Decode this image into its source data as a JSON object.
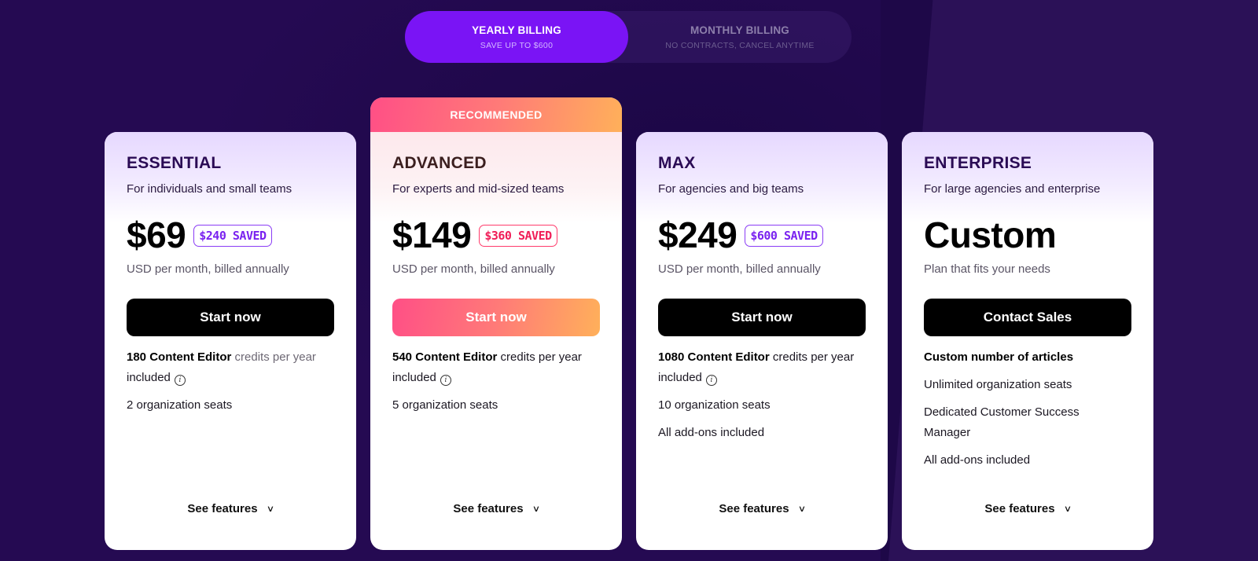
{
  "billing_toggle": {
    "selected": "yearly",
    "yearly": {
      "title": "YEARLY BILLING",
      "subtitle": "SAVE UP TO $600"
    },
    "monthly": {
      "title": "MONTHLY BILLING",
      "subtitle": "NO CONTRACTS, CANCEL ANYTIME"
    }
  },
  "colors": {
    "background": "#250a52",
    "accent_purple": "#7a14f5",
    "recommended_gradient": [
      "#ff4f86",
      "#ffb05a"
    ],
    "cta_dark": "#000000"
  },
  "plans": [
    {
      "name": "ESSENTIAL",
      "description": "For individuals and small teams",
      "price": "$69",
      "saved": "$240 SAVED",
      "price_note": "USD per month, billed annually",
      "cta": "Start now",
      "features": {
        "credits_bold": "180 Content Editor",
        "credits_rest": "credits per year",
        "credits_tail": "included",
        "items": [
          "2 organization seats"
        ]
      },
      "see_features": "See features"
    },
    {
      "name": "ADVANCED",
      "badge": "RECOMMENDED",
      "description": "For experts and mid-sized teams",
      "price": "$149",
      "saved": "$360 SAVED",
      "price_note": "USD per month, billed annually",
      "cta": "Start now",
      "features": {
        "credits_bold": "540 Content Editor",
        "credits_rest": "credits per year included",
        "items": [
          "5 organization seats"
        ]
      },
      "see_features": "See features"
    },
    {
      "name": "MAX",
      "description": "For agencies and big teams",
      "price": "$249",
      "saved": "$600 SAVED",
      "price_note": "USD per month, billed annually",
      "cta": "Start now",
      "features": {
        "credits_bold": "1080 Content Editor",
        "credits_rest": "credits per year included",
        "items": [
          "10 organization seats",
          "All add-ons included"
        ]
      },
      "see_features": "See features"
    },
    {
      "name": "ENTERPRISE",
      "description": "For large agencies and enterprise",
      "price": "Custom",
      "price_note": "Plan that fits your needs",
      "cta": "Contact Sales",
      "features": {
        "headline_bold": "Custom number of articles",
        "items": [
          "Unlimited organization seats",
          "Dedicated Customer Success Manager",
          "All add-ons included"
        ]
      },
      "see_features": "See features"
    }
  ]
}
